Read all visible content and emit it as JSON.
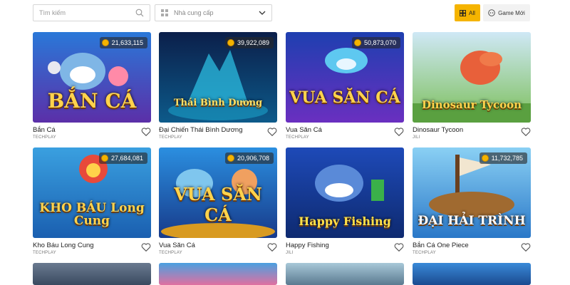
{
  "search": {
    "placeholder": "Tìm kiếm"
  },
  "provider_filter": {
    "label": "Nhà cung cấp"
  },
  "filters": {
    "all_label": "All",
    "new_label": "Game Mới"
  },
  "games": [
    {
      "name": "Bắn Cá",
      "provider": "TECHPLAY",
      "jackpot": "21,633,115",
      "art_text": "BẮN CÁ"
    },
    {
      "name": "Đại Chiến Thái Bình Dương",
      "provider": "TECHPLAY",
      "jackpot": "39,922,089",
      "art_text": "Thái Bình Dương"
    },
    {
      "name": "Vua Săn Cá",
      "provider": "TECHPLAY",
      "jackpot": "50,873,070",
      "art_text": "VUA SĂN CÁ"
    },
    {
      "name": "Dinosaur Tycoon",
      "provider": "JILI",
      "jackpot": "",
      "art_text": "Dinosaur Tycoon"
    },
    {
      "name": "Kho Báu Long Cung",
      "provider": "TECHPLAY",
      "jackpot": "27,684,081",
      "art_text": "KHO BÁU Long Cung"
    },
    {
      "name": "Vua Săn Cá",
      "provider": "TECHPLAY",
      "jackpot": "20,906,708",
      "art_text": "VUA SĂN CÁ"
    },
    {
      "name": "Happy Fishing",
      "provider": "JILI",
      "jackpot": "",
      "art_text": "Happy Fishing"
    },
    {
      "name": "Bắn Cá One Piece",
      "provider": "TECHPLAY",
      "jackpot": "11,732,785",
      "art_text": "ĐẠI HẢI TRÌNH"
    }
  ],
  "colors": {
    "accent": "#f5b400"
  }
}
